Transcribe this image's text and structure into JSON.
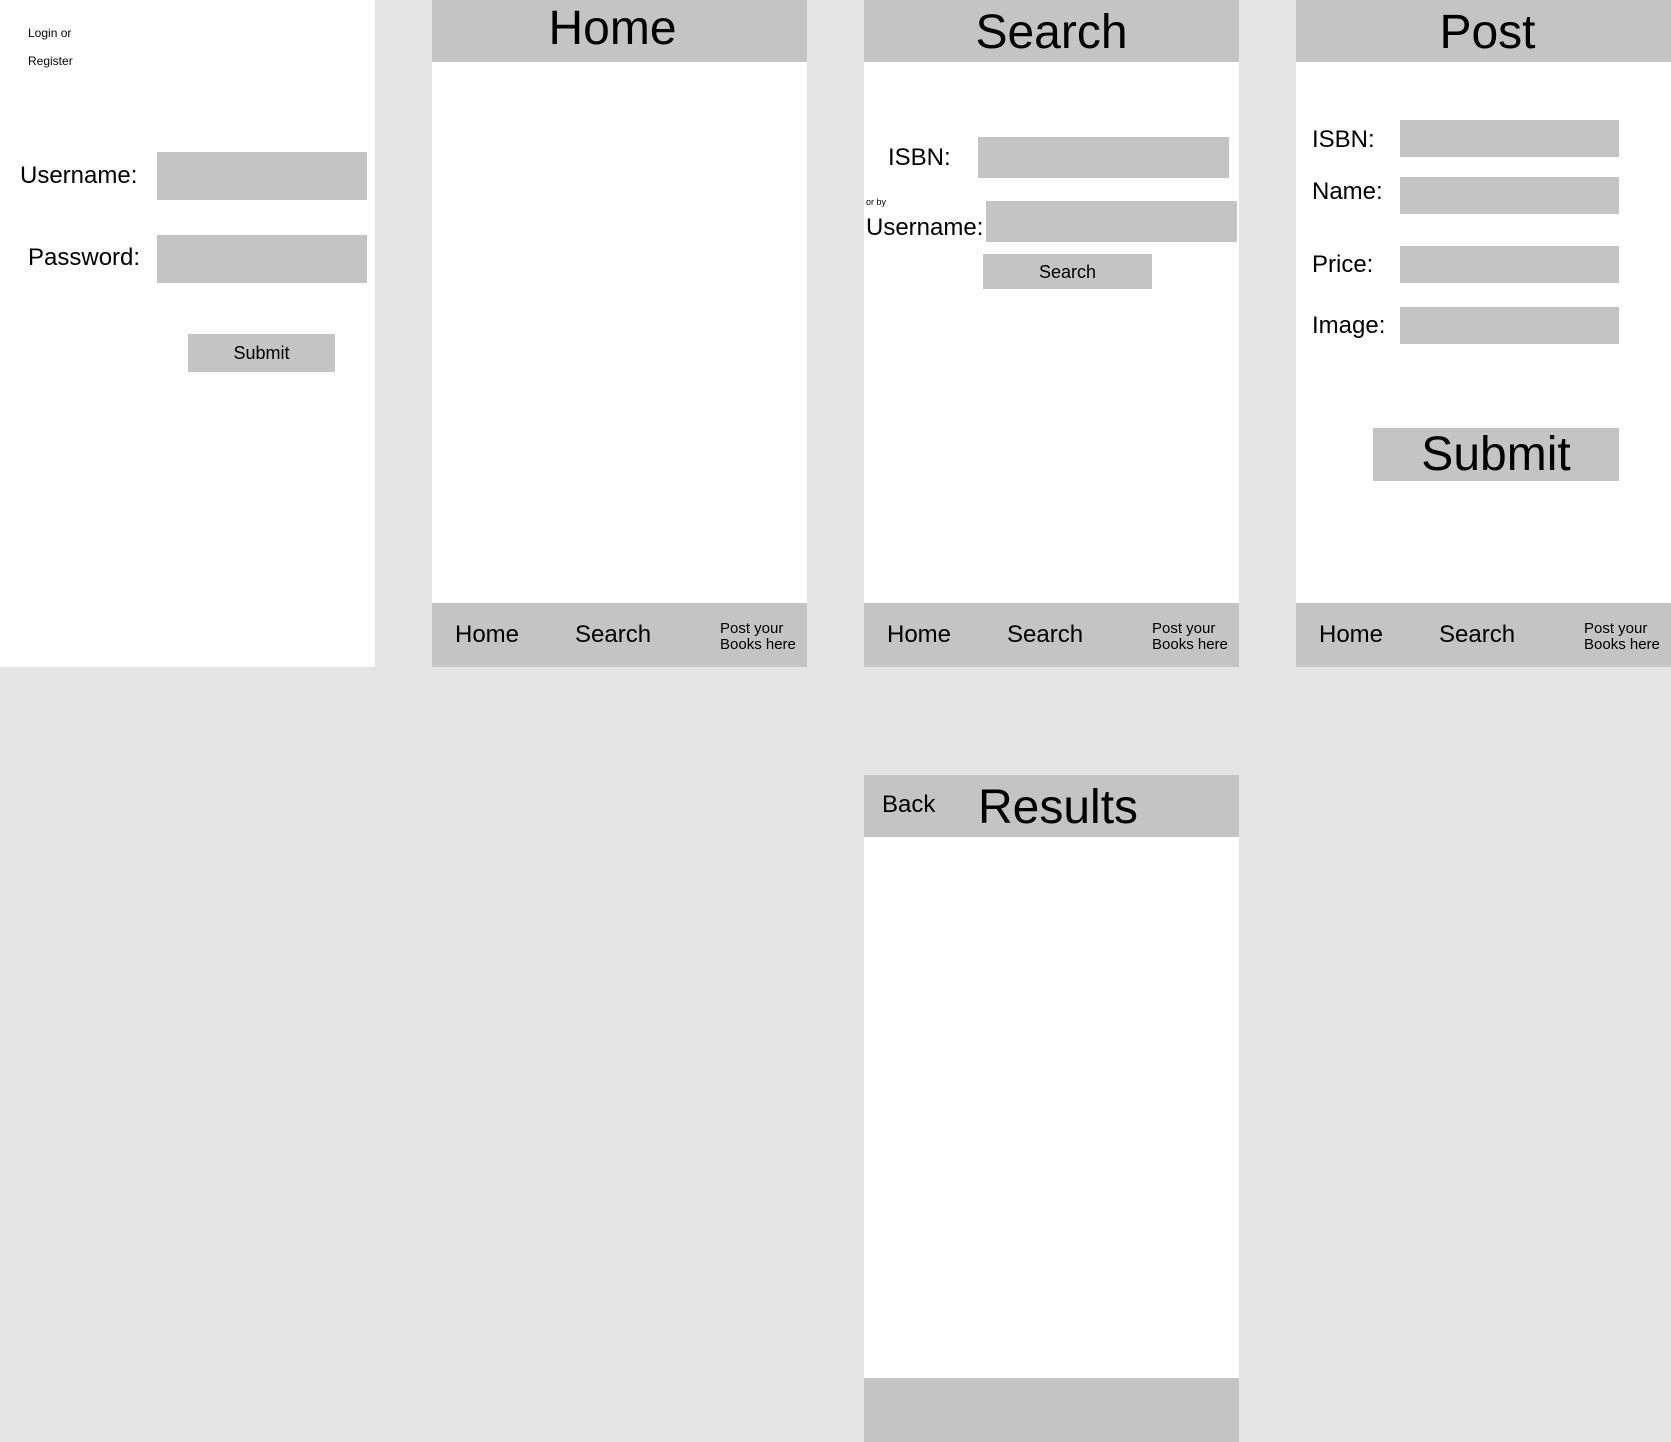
{
  "login": {
    "link_login": "Login or",
    "link_register": "Register",
    "username_label": "Username:",
    "username_value": "",
    "password_label": "Password:",
    "password_value": "",
    "submit_label": "Submit"
  },
  "home": {
    "title": "Home"
  },
  "search": {
    "title": "Search",
    "isbn_label": "ISBN:",
    "isbn_value": "",
    "or_by": "or by",
    "username_label": "Username:",
    "username_value": "",
    "search_button": "Search"
  },
  "post": {
    "title": "Post",
    "isbn_label": "ISBN:",
    "name_label": "Name:",
    "price_label": "Price:",
    "image_label": "Image:",
    "submit_label": "Submit"
  },
  "results": {
    "back_label": "Back",
    "title": "Results"
  },
  "nav": {
    "home": "Home",
    "search": "Search",
    "post_line1": "Post your",
    "post_line2": "Books here"
  },
  "colors": {
    "canvas_bg": "#e4e4e4",
    "screen_bg": "#ffffff",
    "bar_gray": "#c4c4c4"
  }
}
